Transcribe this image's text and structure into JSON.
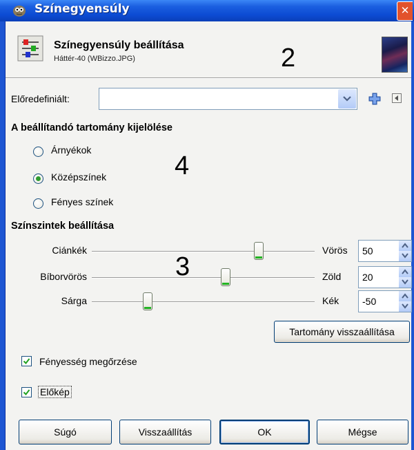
{
  "window": {
    "title": "Színegyensúly",
    "close_glyph": "✕"
  },
  "header": {
    "title": "Színegyensúly beállítása",
    "subtitle": "Háttér-40 (WBizzo.JPG)",
    "icon": "color-balance-icon",
    "thumbnail": "image-thumbnail"
  },
  "annotations": {
    "a2": "2",
    "a4": "4",
    "a3": "3"
  },
  "presets": {
    "label": "Előredefiniált:",
    "value": ""
  },
  "range": {
    "title": "A beállítandó tartomány kijelölése",
    "options": [
      {
        "label": "Árnyékok",
        "selected": false
      },
      {
        "label": "Középszínek",
        "selected": true
      },
      {
        "label": "Fényes színek",
        "selected": false
      }
    ]
  },
  "levels": {
    "title": "Színszintek beállítása",
    "rows": [
      {
        "left": "Ciánkék",
        "right": "Vörös",
        "value": "50",
        "numeric": 50
      },
      {
        "left": "Bíborvörös",
        "right": "Zöld",
        "value": "20",
        "numeric": 20
      },
      {
        "left": "Sárga",
        "right": "Kék",
        "value": "-50",
        "numeric": -50
      }
    ],
    "range_min": -100,
    "range_max": 100,
    "reset_label": "Tartomány visszaállítása"
  },
  "options": {
    "preserve_luminosity": {
      "label": "Fényesség megőrzése",
      "checked": true
    },
    "preview": {
      "label": "Előkép",
      "checked": true
    }
  },
  "buttons": {
    "help": "Súgó",
    "reset": "Visszaállítás",
    "ok": "OK",
    "cancel": "Mégse"
  },
  "colors": {
    "titlebar": "#1b5fe0",
    "accent_green": "#22b322"
  }
}
